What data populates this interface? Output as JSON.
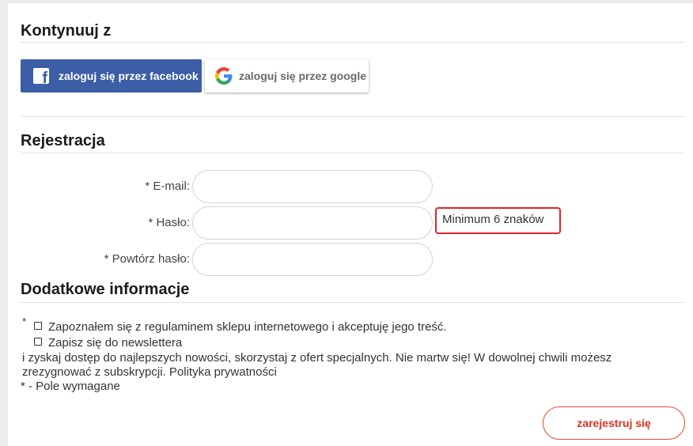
{
  "continue_section": {
    "title": "Kontynuuj z",
    "facebook_label": "zaloguj się przez facebook",
    "google_label": "zaloguj się przez google"
  },
  "registration": {
    "title": "Rejestracja",
    "email_label": "* E-mail:",
    "password_label": "* Hasło:",
    "repeat_password_label": "* Powtórz hasło:",
    "email_value": "",
    "password_value": "",
    "repeat_password_value": "",
    "password_hint": "Minimum 6 znaków"
  },
  "additional": {
    "title": "Dodatkowe informacje",
    "required_star": "*",
    "terms_label": "Zapoznałem się z regulaminem sklepu internetowego i akceptuję jego treść.",
    "newsletter_label": "Zapisz się do newslettera",
    "newsletter_desc_line1": "i zyskaj dostęp do najlepszych nowości, skorzystaj z ofert specjalnych. Nie martw się! W dowolnej chwili możesz",
    "newsletter_desc_line2": "zrezygnować z subskrypcji. Polityka prywatności",
    "required_note": "* - Pole wymagane"
  },
  "submit": {
    "label": "zarejestruj się"
  },
  "colors": {
    "facebook": "#3b5ea6",
    "accent_red": "#e0311e",
    "hint_border": "#e0232b"
  },
  "icons": [
    "facebook-icon",
    "google-icon"
  ]
}
